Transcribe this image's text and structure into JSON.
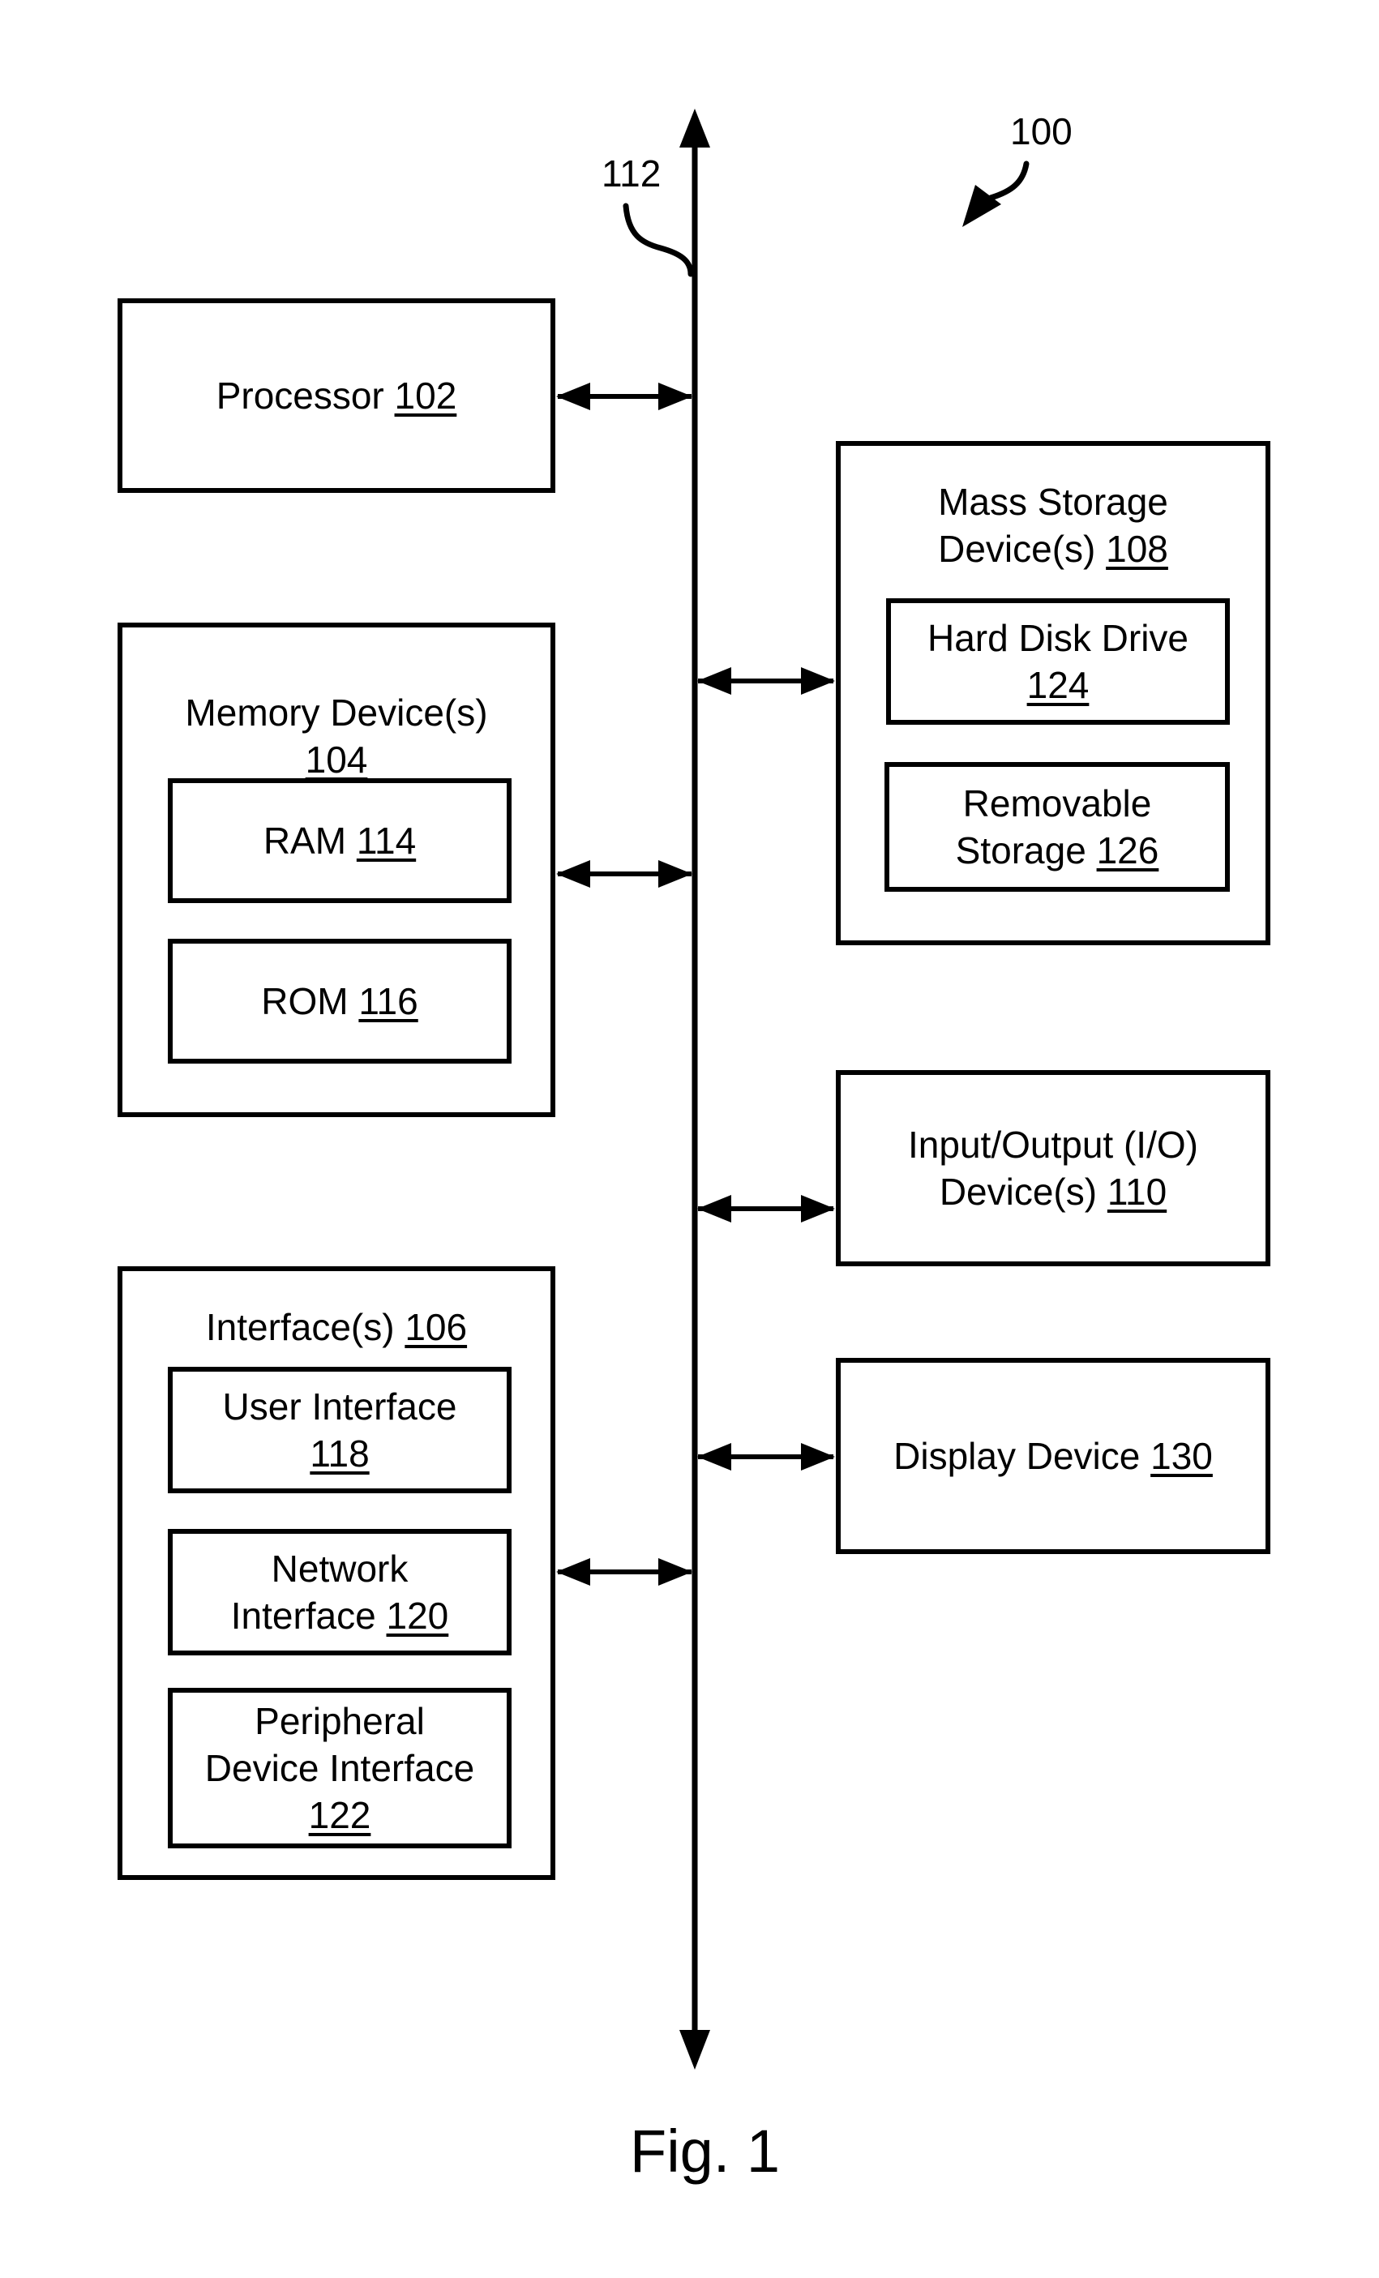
{
  "figure": {
    "caption": "Fig. 1",
    "system_ref": "100",
    "bus_ref": "112"
  },
  "components": {
    "processor": {
      "name": "Processor",
      "ref": "102"
    },
    "memory": {
      "name": "Memory Device(s)",
      "ref": "104",
      "children": [
        {
          "name": "RAM",
          "ref": "114"
        },
        {
          "name": "ROM",
          "ref": "116"
        }
      ]
    },
    "interfaces": {
      "name": "Interface(s)",
      "ref": "106",
      "children": [
        {
          "name_line1": "User Interface",
          "name_line2": "",
          "ref": "118"
        },
        {
          "name_line1": "Network",
          "name_line2": "Interface",
          "ref": "120"
        },
        {
          "name_line1": "Peripheral",
          "name_line2": "Device Interface",
          "ref": "122"
        }
      ]
    },
    "mass_storage": {
      "name_line1": "Mass Storage",
      "name_line2": "Device(s)",
      "ref": "108",
      "children": [
        {
          "name": "Hard Disk Drive",
          "ref": "124"
        },
        {
          "name_line1": "Removable",
          "name_line2": "Storage",
          "ref": "126"
        }
      ]
    },
    "io": {
      "name_line1": "Input/Output (I/O)",
      "name_line2": "Device(s)",
      "ref": "110"
    },
    "display": {
      "name": "Display Device",
      "ref": "130"
    }
  }
}
